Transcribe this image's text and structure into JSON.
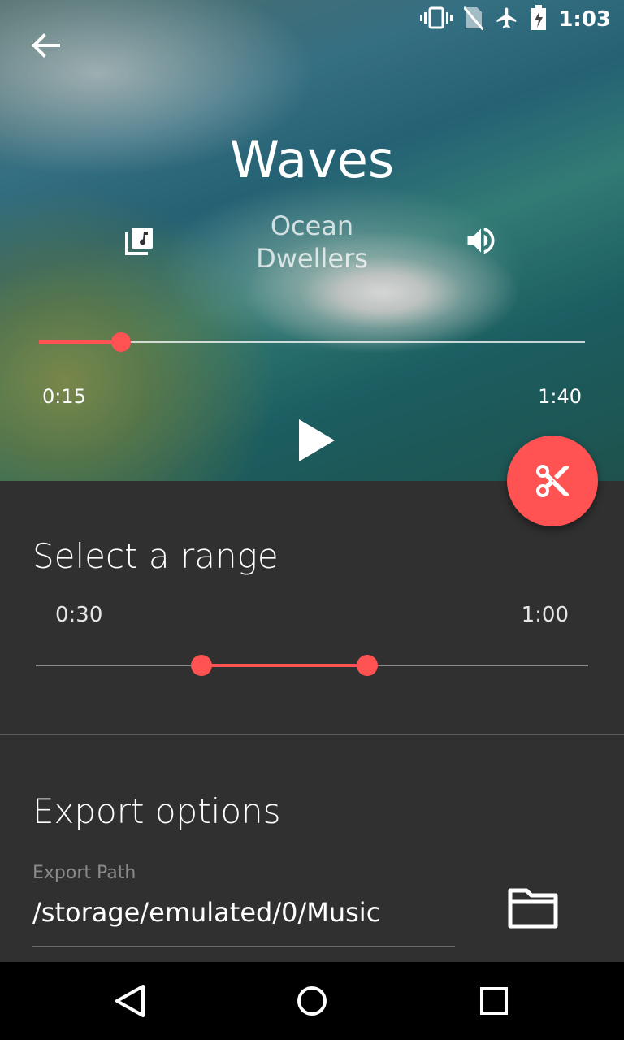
{
  "status_bar": {
    "time": "1:03",
    "icons": [
      "vibrate-icon",
      "no-sim-icon",
      "airplane-mode-icon",
      "battery-charging-icon"
    ]
  },
  "player": {
    "title": "Waves",
    "artist": "Ocean Dwellers",
    "current_time": "0:15",
    "total_time": "1:40",
    "progress": 0.15,
    "icons": {
      "back": "arrow-back-icon",
      "playlist": "library-music-icon",
      "volume": "volume-up-icon",
      "play": "play-icon",
      "fab": "scissors-icon"
    }
  },
  "range": {
    "title": "Select a range",
    "start_label": "0:30",
    "end_label": "1:00",
    "start_fraction": 0.3,
    "end_fraction": 0.6
  },
  "export": {
    "title": "Export options",
    "path_label": "Export Path",
    "path_value": "/storage/emulated/0/Music",
    "folder_icon": "folder-icon"
  },
  "nav": {
    "icons": [
      "back-triangle-icon",
      "home-circle-icon",
      "recents-square-icon"
    ]
  },
  "colors": {
    "accent": "#ff5252",
    "background": "#303030",
    "navbar": "#000000"
  }
}
